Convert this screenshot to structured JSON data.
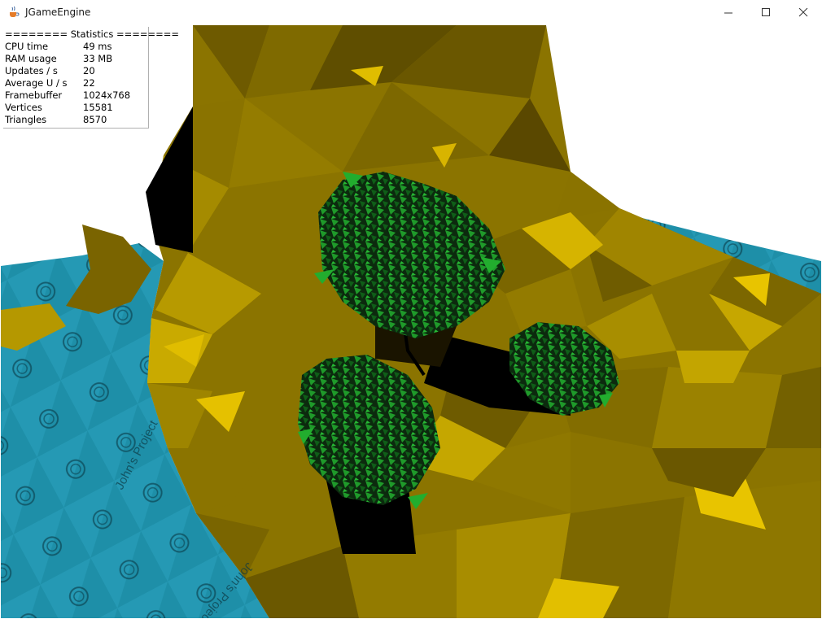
{
  "window": {
    "title": "JGameEngine",
    "icon": "java-cup-icon",
    "controls": [
      "minimize-icon",
      "maximize-icon",
      "close-icon"
    ]
  },
  "stats": {
    "header": "======== Statistics ========",
    "rows": [
      {
        "label": "CPU time",
        "value": "49 ms"
      },
      {
        "label": "RAM usage",
        "value": "33 MB"
      },
      {
        "label": "Updates / s",
        "value": "20"
      },
      {
        "label": "Average U / s",
        "value": "22"
      },
      {
        "label": "Framebuffer",
        "value": "1024x768"
      },
      {
        "label": "Vertices",
        "value": "15581"
      },
      {
        "label": "Triangles",
        "value": "8570"
      }
    ]
  },
  "scene": {
    "water_texture_text": "John's Project",
    "colors": {
      "terrain_dark": "#7a6400",
      "terrain_mid": "#a08a00",
      "terrain_light": "#e0bd00",
      "water": "#1e8fa8",
      "foliage": "#1f9a2a",
      "shadow": "#000000"
    }
  }
}
